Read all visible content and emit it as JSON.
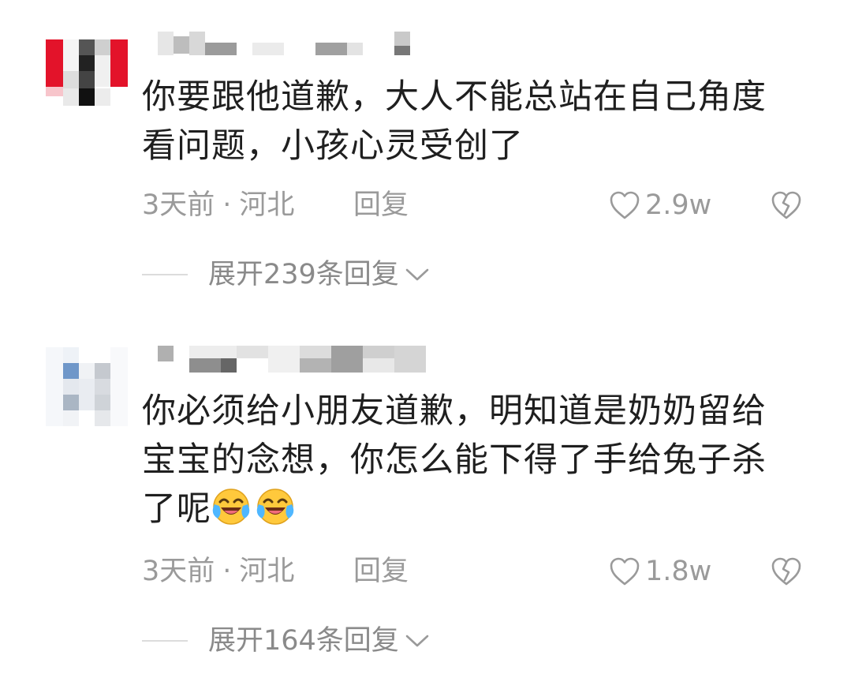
{
  "comments": [
    {
      "text": "你要跟他道歉，大人不能总站在自己角度\n看问题，小孩心灵受创了",
      "time": "3天前",
      "location": "河北",
      "reply_label": "回复",
      "likes": "2.9w",
      "expand_label": "展开239条回复"
    },
    {
      "text_part": "你必须给小朋友道歉，明知道是奶奶留给\n宝宝的念想，你怎么能下得了手给兔子杀\n了呢",
      "emojis": [
        "laughing-crying-emoji",
        "laughing-crying-emoji"
      ],
      "time": "3天前",
      "location": "河北",
      "reply_label": "回复",
      "likes": "1.8w",
      "expand_label": "展开164条回复"
    }
  ],
  "meta_separator": "·",
  "icons": {
    "like": "heart-outline-icon",
    "dislike": "broken-heart-icon",
    "expand": "chevron-down-icon"
  },
  "colors": {
    "text": "#1f1f1f",
    "meta": "#9a9a9a",
    "avatar1_accent": "#e3132a",
    "avatar2_accent": "#6f97c9",
    "emoji_face": "#ffc93c"
  }
}
